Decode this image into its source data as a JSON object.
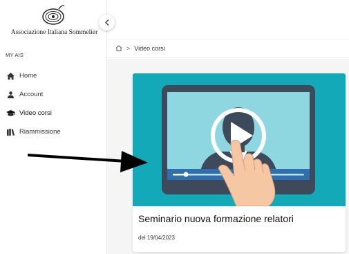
{
  "sidebar": {
    "logo_text": "Associazione Italiana Sommelier",
    "section_title": "MY AIS",
    "items": [
      {
        "label": "Home",
        "icon": "home-icon"
      },
      {
        "label": "Account",
        "icon": "user-icon"
      },
      {
        "label": "Video corsi",
        "icon": "graduation-cap-icon"
      },
      {
        "label": "Riammissione",
        "icon": "books-icon"
      }
    ]
  },
  "breadcrumb": {
    "home_icon": "home-icon",
    "separator": ">",
    "current": "Video corsi"
  },
  "card": {
    "title": "Seminario nuova formazione relatori",
    "date": "del 19/04/2023",
    "thumbnail": "video-play-illustration"
  },
  "colors": {
    "thumbnail_bg": "#14a9b8",
    "arrow": "#000000"
  }
}
